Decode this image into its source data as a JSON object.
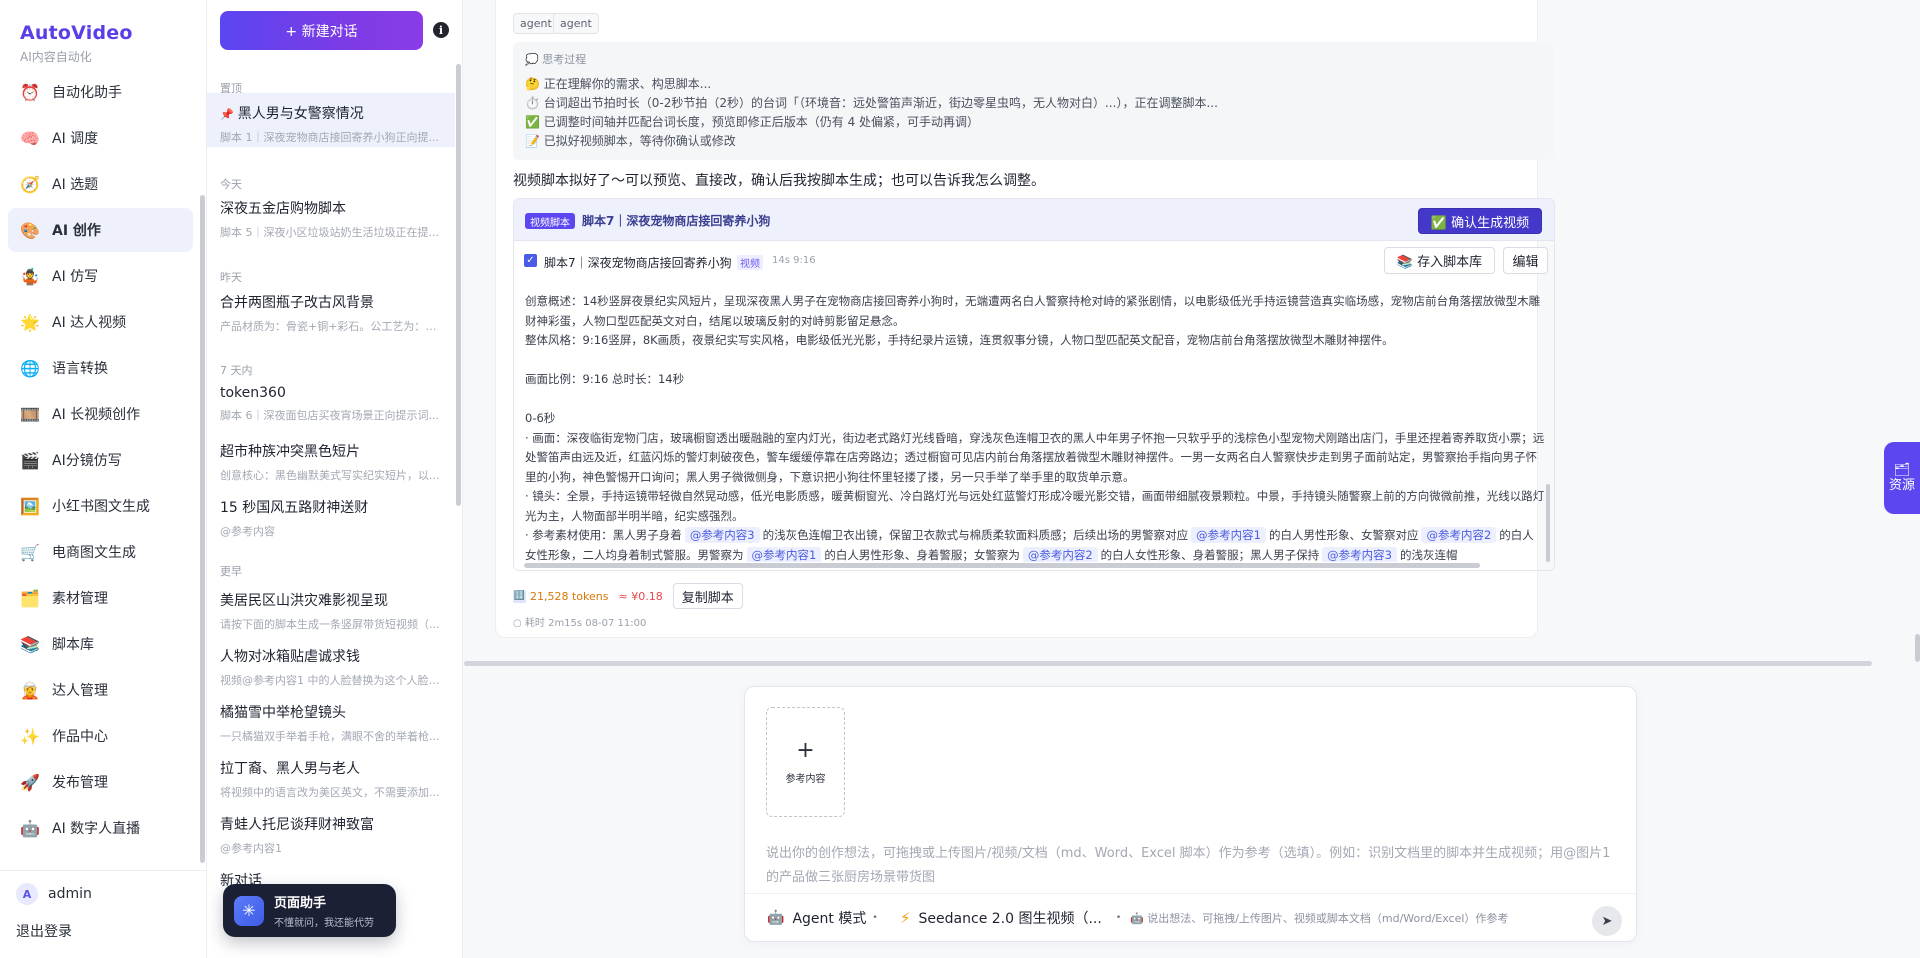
{
  "brand": {
    "name": "AutoVideo",
    "subtitle": "AI内容自动化"
  },
  "nav": {
    "items": [
      {
        "label": "自动化助手",
        "icon": "⏰",
        "icon_name": "alarm-clock-icon"
      },
      {
        "label": "AI 调度",
        "icon": "🧠",
        "icon_name": "brain-icon"
      },
      {
        "label": "AI 选题",
        "icon": "🧭",
        "icon_name": "compass-icon"
      },
      {
        "label": "AI 创作",
        "icon": "🎨",
        "icon_name": "palette-icon",
        "active": true
      },
      {
        "label": "AI 仿写",
        "icon": "🤹",
        "icon_name": "juggler-icon"
      },
      {
        "label": "AI 达人视频",
        "icon": "🌟",
        "icon_name": "star-icon"
      },
      {
        "label": "语言转换",
        "icon": "🌐",
        "icon_name": "globe-icon"
      },
      {
        "label": "AI 长视频创作",
        "icon": "🎞️",
        "icon_name": "film-icon"
      },
      {
        "label": "AI分镜仿写",
        "icon": "🎬",
        "icon_name": "clapper-icon"
      },
      {
        "label": "小红书图文生成",
        "icon": "🖼️",
        "icon_name": "picture-icon"
      },
      {
        "label": "电商图文生成",
        "icon": "🛒",
        "icon_name": "cart-icon"
      },
      {
        "label": "素材管理",
        "icon": "🗂️",
        "icon_name": "folder-icon"
      },
      {
        "label": "脚本库",
        "icon": "📚",
        "icon_name": "books-icon"
      },
      {
        "label": "达人管理",
        "icon": "🧝",
        "icon_name": "person-icon"
      },
      {
        "label": "作品中心",
        "icon": "✨",
        "icon_name": "sparkles-icon"
      },
      {
        "label": "发布管理",
        "icon": "🚀",
        "icon_name": "rocket-icon"
      },
      {
        "label": "AI 数字人直播",
        "icon": "🤖",
        "icon_name": "robot-icon"
      }
    ]
  },
  "user": {
    "avatar": "A",
    "name": "admin",
    "logout": "退出登录"
  },
  "conversations": {
    "new_chat": "+ 新建对话",
    "info": "i",
    "groups": [
      {
        "label": "置顶",
        "items": [
          {
            "title": "黑人男与女警察情况",
            "snippet": "脚本 1｜深夜宠物商店接回寄养小狗正向提...",
            "pinned": true,
            "active": true
          }
        ]
      },
      {
        "label": "今天",
        "items": [
          {
            "title": "深夜五金店购物脚本",
            "snippet": "脚本 5｜深夜小区垃圾站奶生活垃圾正在提..."
          }
        ]
      },
      {
        "label": "昨天",
        "items": [
          {
            "title": "合并两图瓶子改古风背景",
            "snippet": "产品材质为：骨瓷+铜+彩石。公工艺为：镂..."
          }
        ]
      },
      {
        "label": "7 天内",
        "items": [
          {
            "title": "token360",
            "snippet": "脚本 6｜深夜面包店买夜宵场景正向提示词..."
          },
          {
            "title": "超市种族冲突黑色短片",
            "snippet": "创意核心：黑色幽默美式写实纪实短片，以..."
          },
          {
            "title": "15 秒国风五路财神送财",
            "snippet": "@参考内容"
          }
        ]
      },
      {
        "label": "更早",
        "items": [
          {
            "title": "美居民区山洪灾难影视呈现",
            "snippet": "请按下面的脚本生成一条竖屏带货短视频（..."
          },
          {
            "title": "人物对冰箱贴虐诚求钱",
            "snippet": "视频@参考内容1 中的人脸替换为这个人脸@..."
          },
          {
            "title": "橘猫雪中举枪望镜头",
            "snippet": "一只橘猫双手举着手枪，满眼不舍的举着枪..."
          },
          {
            "title": "拉丁裔、黑人男与老人",
            "snippet": "将视频中的语言改为美区英文，不需要添加..."
          },
          {
            "title": "青蛙人托尼谈拜财神致富",
            "snippet": "@参考内容1"
          },
          {
            "title": "新对话",
            "snippet": ""
          }
        ]
      }
    ]
  },
  "helper": {
    "title": "页面助手",
    "subtitle": "不懂就问，我还能代劳",
    "icon": "✳"
  },
  "message": {
    "tags": [
      "agent",
      "agent"
    ],
    "thinking": {
      "title": "💭 思考过程",
      "lines": [
        "🤔 正在理解你的需求、构思脚本...",
        "⏱️ 台词超出节拍时长（0-2秒节拍（2秒）的台词「（环境音：远处警笛声渐近，街边零星虫鸣，无人物对白）...），正在调整脚本...",
        "✅ 已调整时间轴并匹配台词长度，预览即修正后版本（仍有 4 处偏紧，可手动再调）",
        "📝 已拟好视频脚本，等待你确认或修改"
      ]
    },
    "reply": "视频脚本拟好了～可以预览、直接改，确认后我按脚本生成；也可以告诉我怎么调整。",
    "script": {
      "badge": "视频脚本",
      "title": "脚本7｜深夜宠物商店接回寄养小狗",
      "confirm": "✅ 确认生成视频",
      "checked": "✓",
      "row_title": "脚本7｜深夜宠物商店接回寄养小狗",
      "row_tag": "视频",
      "row_meta": "14s  9:16",
      "save": "📚 存入脚本库",
      "edit": "编辑",
      "p1": "创意概述：14秒竖屏夜景纪实风短片，呈现深夜黑人男子在宠物商店接回寄养小狗时，无端遭两名白人警察持枪对峙的紧张剧情，以电影级低光手持运镜营造真实临场感，宠物店前台角落摆放微型木雕财神彩蛋，人物口型匹配英文对白，结尾以玻璃反射的对峙剪影留足悬念。",
      "p2": "整体风格：9:16竖屏，8K画质，夜景纪实写实风格，电影级低光光影，手持纪录片运镜，连贯叙事分镜，人物口型匹配英文配音，宠物店前台角落摆放微型木雕财神摆件。",
      "p3": "画面比例：9:16    总时长：14秒",
      "p4": "0-6秒",
      "p5": "· 画面：深夜临街宠物门店，玻璃橱窗透出暖融融的室内灯光，街边老式路灯光线昏暗，穿浅灰色连帽卫衣的黑人中年男子怀抱一只软乎乎的浅棕色小型宠物犬刚踏出店门，手里还捏着寄养取货小票；远处警笛声由远及近，红蓝闪烁的警灯刺破夜色，警车缓缓停靠在店旁路边；透过橱窗可见店内前台角落摆放着微型木雕财神摆件。一男一女两名白人警察快步走到男子面前站定，男警察抬手指向男子怀里的小狗，神色警惕开口询问；黑人男子微微侧身，下意识把小狗往怀里轻搂了搂，另一只手举了举手里的取货单示意。",
      "p6": "· 镜头：全景，手持运镜带轻微自然晃动感，低光电影质感，暖黄橱窗光、冷白路灯光与远处红蓝警灯形成冷暖光影交错，画面带细腻夜景颗粒。中景，手持镜头随警察上前的方向微微前推，光线以路灯光为主，人物面部半明半暗，纪实感强烈。",
      "p7_a": "· 参考素材使用：黑人男子身着",
      "ref1": "@参考内容3",
      "p7_b": "的浅灰色连帽卫衣出镜，保留卫衣款式与棉质柔软面料质感；后续出场的男警察对应",
      "ref2": "@参考内容1",
      "p7_c": "的白人男性形象、女警察对应",
      "ref3": "@参考内容2",
      "p7_d": "的白人女性形象，二人均身着制式警服。男警察为",
      "ref4": "@参考内容1",
      "p7_e": "的白人男性形象、身着警服；女警察为",
      "ref5": "@参考内容2",
      "p7_f": "的白人女性形象、身着警服；黑人男子保持",
      "ref6": "@参考内容3",
      "p7_g": "的浅灰连帽"
    },
    "tokens": "21,528 tokens",
    "token_icon": "🔢",
    "cost": "≈ ¥0.18",
    "copy": "复制脚本",
    "elapsed": "○ 耗时 2m15s   08-07 11:00"
  },
  "resources_tab": {
    "icon": "🗂",
    "label": "资源"
  },
  "composer": {
    "ref_plus": "+",
    "ref_label": "参考内容",
    "placeholder": "说出你的创作想法，可拖拽或上传图片/视频/文档（md、Word、Excel 脚本）作为参考（选填）。例如：识别文档里的脚本并生成视频；用@图片1 的产品做三张厨房场景带货图",
    "mode_icon": "🤖",
    "mode": "Agent 模式",
    "model_icon": "⚡",
    "model": "Seedance 2.0 图生视频（...",
    "hint": "🤖 说出想法、可拖拽/上传图片、视频或脚本文档（md/Word/Excel）作参考",
    "send": "➤"
  }
}
